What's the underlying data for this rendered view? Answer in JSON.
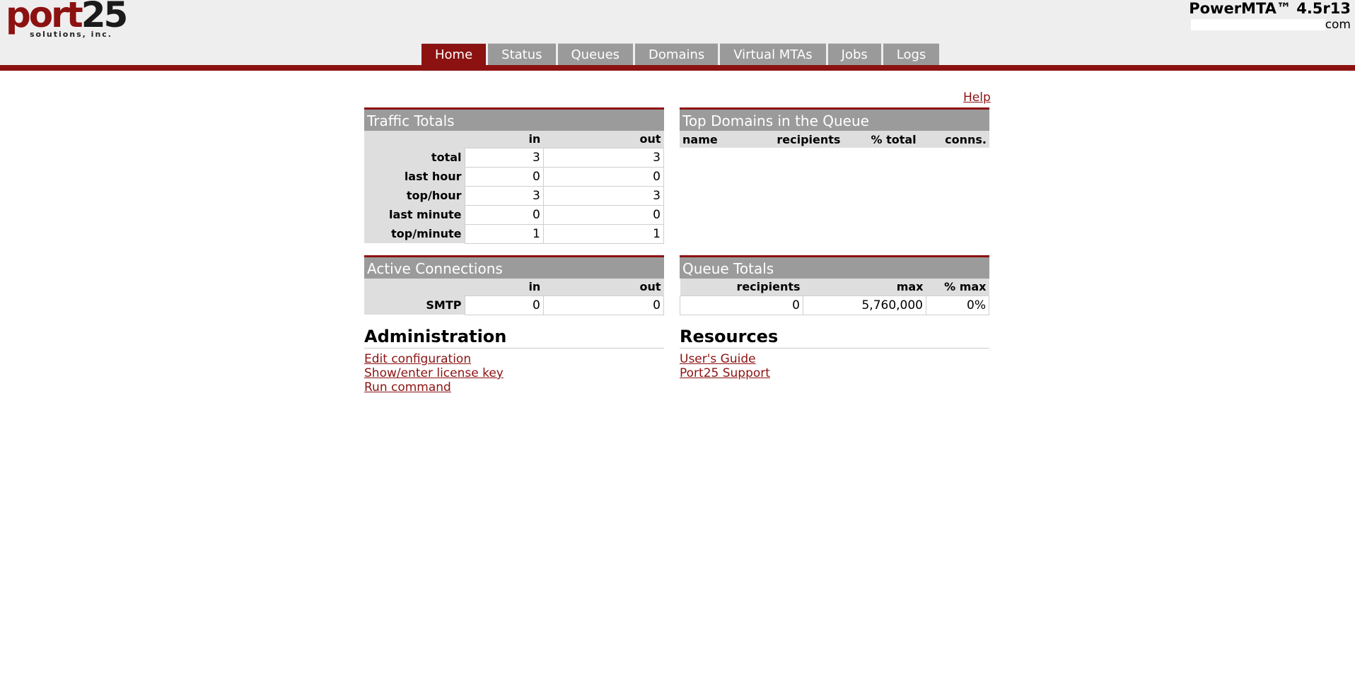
{
  "header": {
    "logo_main_a": "port",
    "logo_main_b": "25",
    "logo_sub": "solutions, inc.",
    "product": "PowerMTA™ 4.5r13",
    "host_suffix": "com"
  },
  "nav": {
    "tabs": [
      "Home",
      "Status",
      "Queues",
      "Domains",
      "Virtual MTAs",
      "Jobs",
      "Logs"
    ],
    "active": "Home"
  },
  "help_label": "Help",
  "traffic_totals": {
    "title": "Traffic Totals",
    "col_in": "in",
    "col_out": "out",
    "rows": [
      {
        "label": "total",
        "in": "3",
        "out": "3"
      },
      {
        "label": "last hour",
        "in": "0",
        "out": "0"
      },
      {
        "label": "top/hour",
        "in": "3",
        "out": "3"
      },
      {
        "label": "last minute",
        "in": "0",
        "out": "0"
      },
      {
        "label": "top/minute",
        "in": "1",
        "out": "1"
      }
    ]
  },
  "top_domains": {
    "title": "Top Domains in the Queue",
    "col_name": "name",
    "col_recipients": "recipients",
    "col_pct_total": "% total",
    "col_conns": "conns."
  },
  "active_connections": {
    "title": "Active Connections",
    "col_in": "in",
    "col_out": "out",
    "rows": [
      {
        "label": "SMTP",
        "in": "0",
        "out": "0"
      }
    ]
  },
  "queue_totals": {
    "title": "Queue Totals",
    "col_recipients": "recipients",
    "col_max": "max",
    "col_pct_max": "% max",
    "recipients": "0",
    "max": "5,760,000",
    "pct_max": "0%"
  },
  "administration": {
    "title": "Administration",
    "links": [
      "Edit configuration",
      "Show/enter license key",
      "Run command"
    ]
  },
  "resources": {
    "title": "Resources",
    "links": [
      "User's Guide",
      "Port25 Support"
    ]
  },
  "colors": {
    "brand_red": "#8c1212",
    "tab_gray": "#9a9a9a",
    "header_bg": "#efeeef"
  }
}
